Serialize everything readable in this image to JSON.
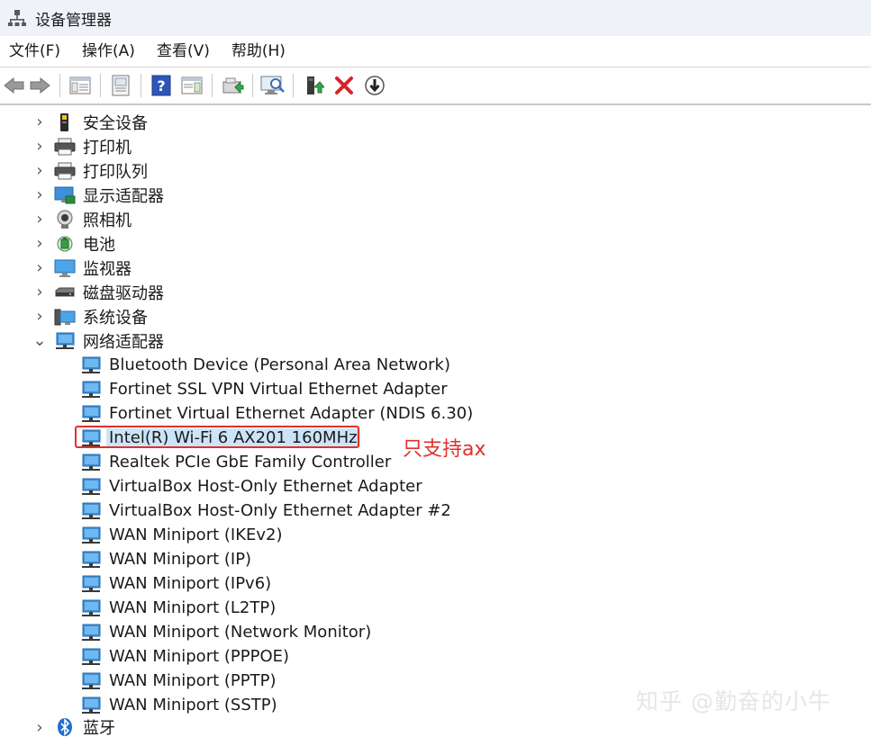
{
  "window": {
    "title": "设备管理器"
  },
  "menu": [
    {
      "label": "文件(F)"
    },
    {
      "label": "操作(A)"
    },
    {
      "label": "查看(V)"
    },
    {
      "label": "帮助(H)"
    }
  ],
  "toolbar": {
    "buttons": [
      "back-arrow-icon",
      "forward-arrow-icon",
      "console-tree-icon",
      "properties-icon",
      "help-icon",
      "action-pane-icon",
      "update-driver-icon",
      "scan-hardware-icon",
      "enable-device-icon",
      "uninstall-device-icon",
      "disable-device-icon"
    ]
  },
  "tree": {
    "categories_top": [
      {
        "label": "安全设备",
        "icon": "security-device-icon"
      },
      {
        "label": "打印机",
        "icon": "printer-icon"
      },
      {
        "label": "打印队列",
        "icon": "print-queue-icon"
      },
      {
        "label": "显示适配器",
        "icon": "display-adapter-icon"
      },
      {
        "label": "照相机",
        "icon": "camera-icon"
      },
      {
        "label": "电池",
        "icon": "battery-icon"
      },
      {
        "label": "监视器",
        "icon": "monitor-icon"
      },
      {
        "label": "磁盘驱动器",
        "icon": "disk-drive-icon"
      },
      {
        "label": "系统设备",
        "icon": "system-device-icon"
      }
    ],
    "network": {
      "label": "网络适配器",
      "children": [
        {
          "label": "Bluetooth Device (Personal Area Network)"
        },
        {
          "label": "Fortinet SSL VPN Virtual Ethernet Adapter"
        },
        {
          "label": "Fortinet Virtual Ethernet Adapter (NDIS 6.30)"
        },
        {
          "label": "Intel(R) Wi-Fi 6 AX201 160MHz"
        },
        {
          "label": "Realtek PCIe GbE Family Controller"
        },
        {
          "label": "VirtualBox Host-Only Ethernet Adapter"
        },
        {
          "label": "VirtualBox Host-Only Ethernet Adapter #2"
        },
        {
          "label": "WAN Miniport (IKEv2)"
        },
        {
          "label": "WAN Miniport (IP)"
        },
        {
          "label": "WAN Miniport (IPv6)"
        },
        {
          "label": "WAN Miniport (L2TP)"
        },
        {
          "label": "WAN Miniport (Network Monitor)"
        },
        {
          "label": "WAN Miniport (PPPOE)"
        },
        {
          "label": "WAN Miniport (PPTP)"
        },
        {
          "label": "WAN Miniport (SSTP)"
        }
      ]
    },
    "bluetooth": {
      "label": "蓝牙"
    }
  },
  "annotation": {
    "text": "只支持ax",
    "color": "#e0302a"
  },
  "watermark": "知乎 @勤奋的小牛",
  "colors": {
    "selection": "#cce4f7",
    "network_icon": "#2b88d8"
  }
}
